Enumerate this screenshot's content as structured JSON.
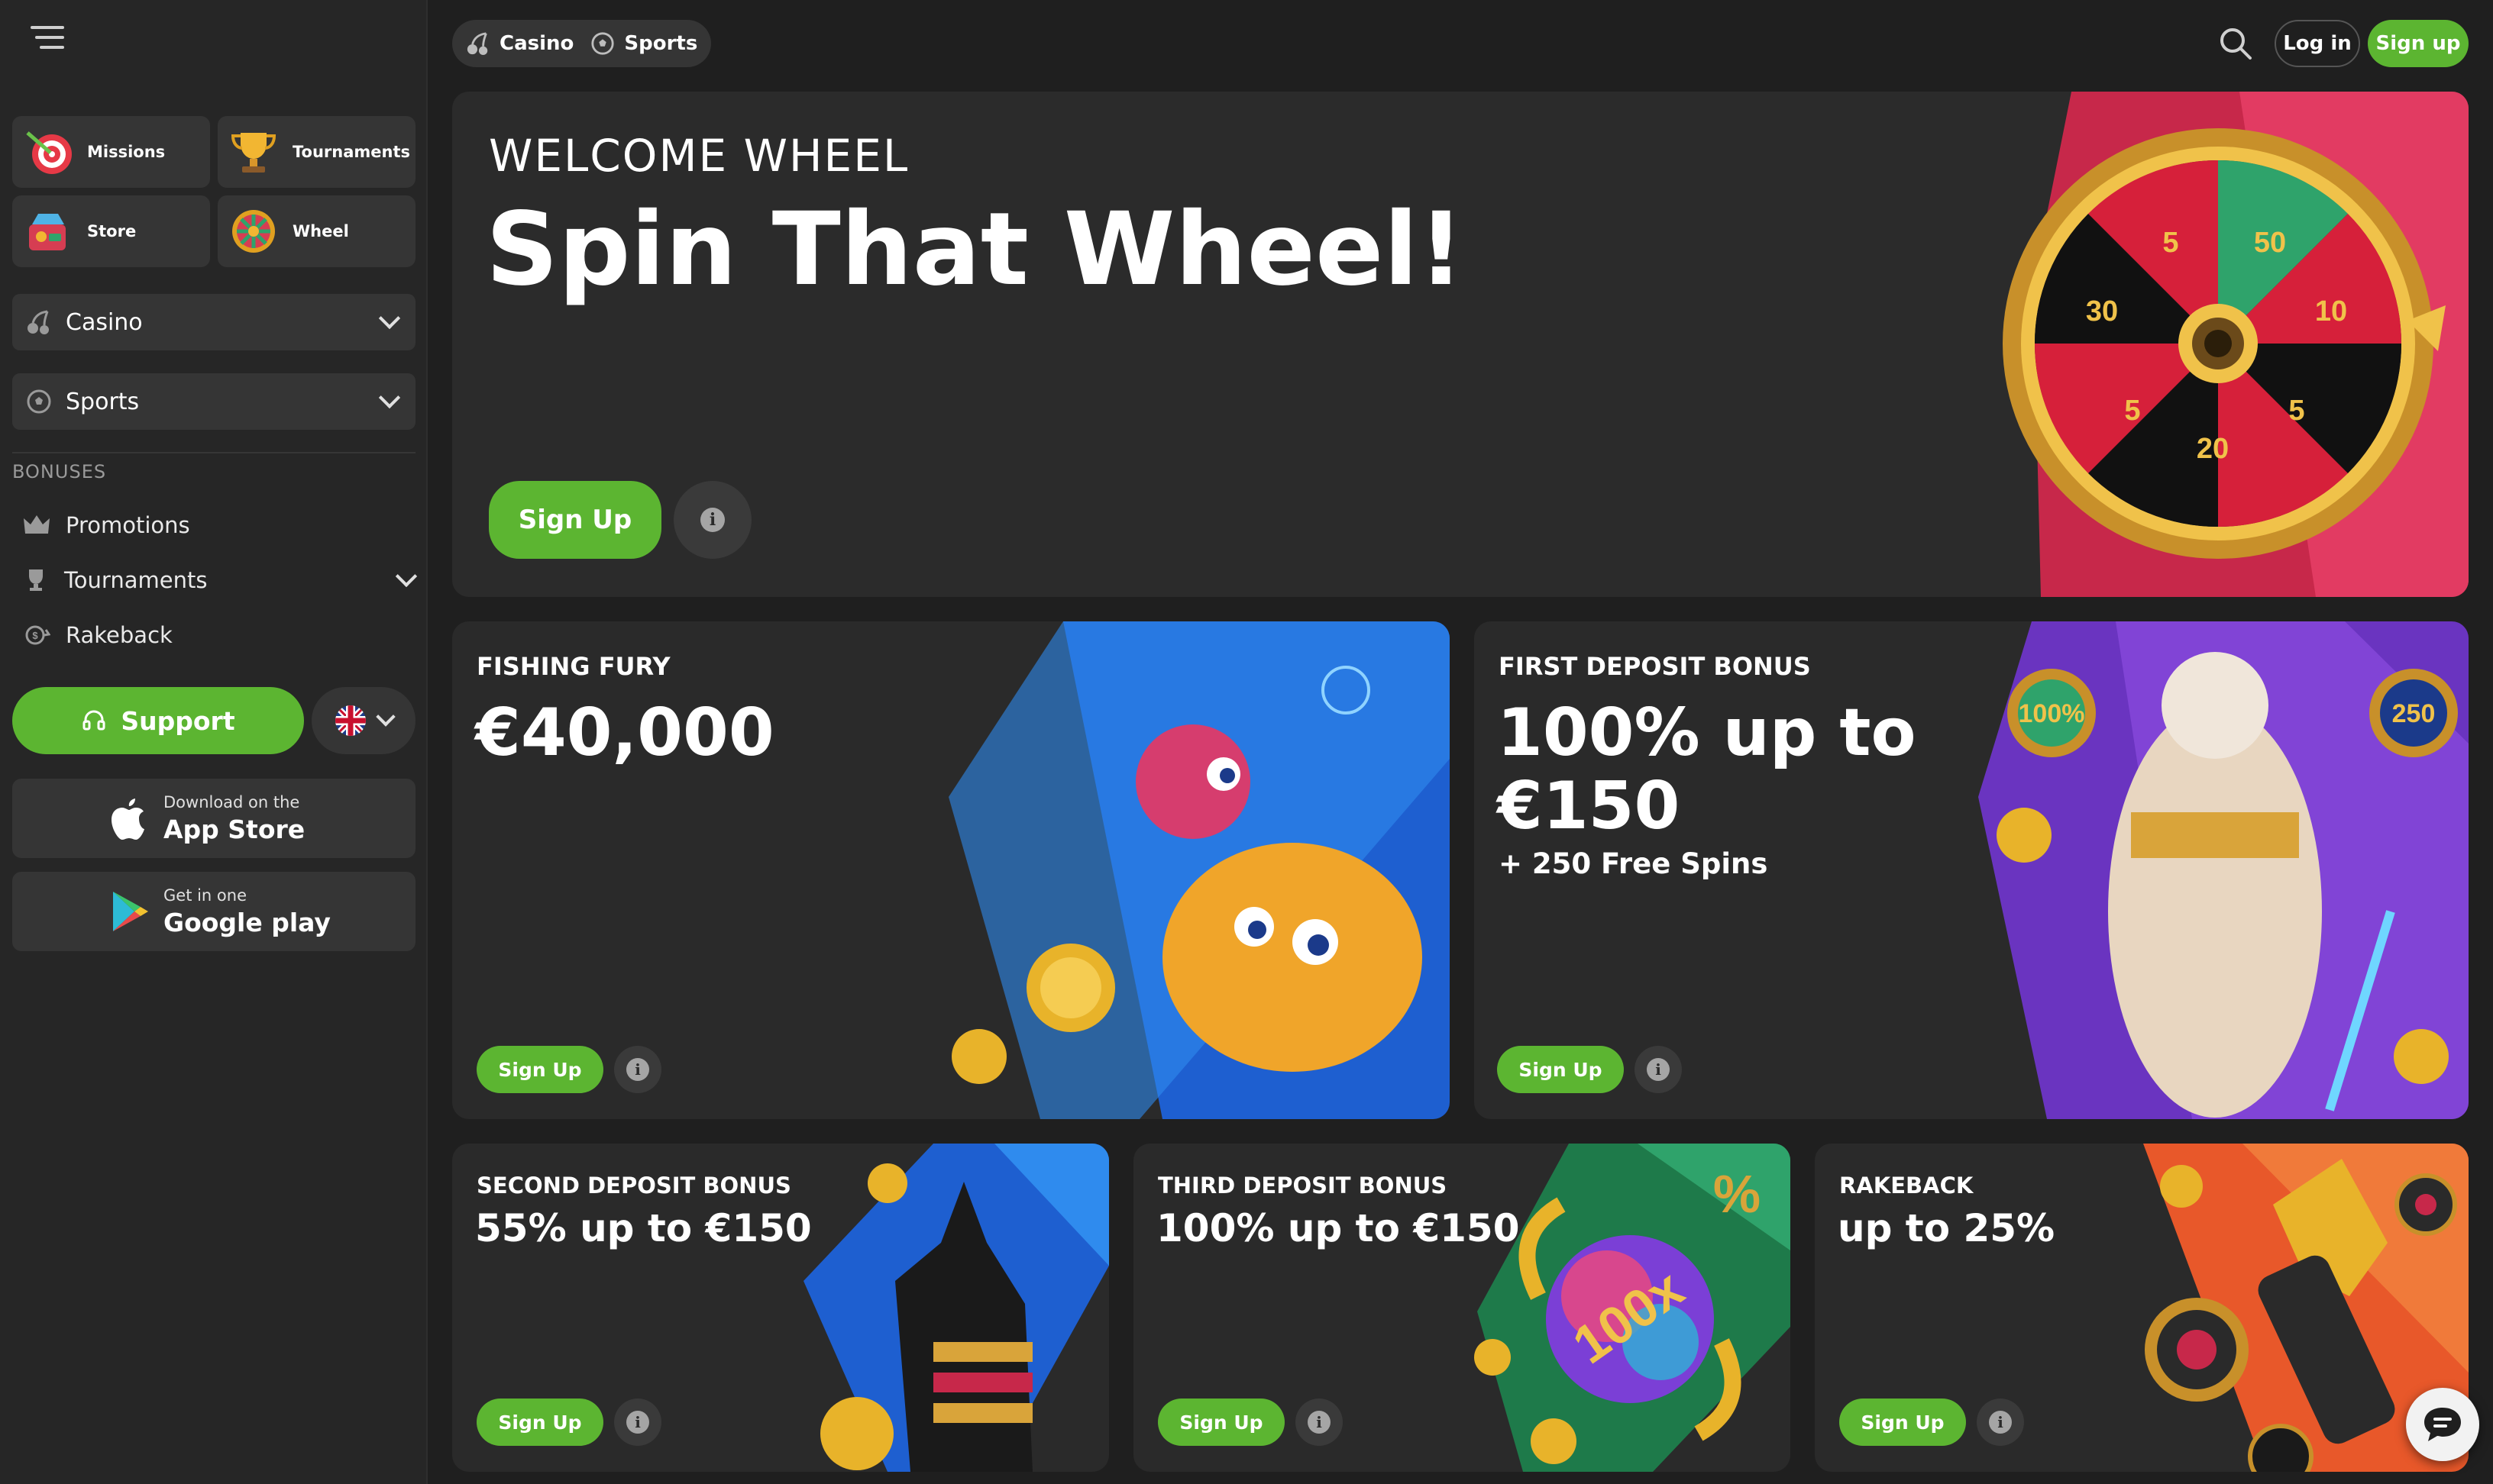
{
  "sidebar": {
    "tiles": [
      {
        "label": "Missions",
        "icon": "dart-target-icon"
      },
      {
        "label": "Tournaments",
        "icon": "trophy-icon"
      },
      {
        "label": "Store",
        "icon": "store-icon"
      },
      {
        "label": "Wheel",
        "icon": "wheel-icon"
      }
    ],
    "casino_label": "Casino",
    "sports_label": "Sports",
    "bonuses_heading": "BONUSES",
    "promotions_label": "Promotions",
    "tournaments_label": "Tournaments",
    "rakeback_label": "Rakeback",
    "support_label": "Support",
    "appstore": {
      "small": "Download on the",
      "big": "App Store"
    },
    "googleplay": {
      "small": "Get in one",
      "big": "Google play"
    }
  },
  "topbar": {
    "casino": "Casino",
    "sports": "Sports",
    "login": "Log in",
    "signup": "Sign up"
  },
  "hero": {
    "kicker": "WELCOME WHEEL",
    "title": "Spin That Wheel!",
    "button": "Sign Up",
    "wheel_values": [
      "5",
      "50",
      "10",
      "5",
      "20",
      "5",
      "30"
    ]
  },
  "cards": {
    "fishing": {
      "kicker": "FISHING FURY",
      "title": "€40,000",
      "button": "Sign Up"
    },
    "first": {
      "kicker": "FIRST DEPOSIT BONUS",
      "title1": "100% up to",
      "title2": "€150",
      "sub": "+ 250 Free Spins",
      "button": "Sign Up",
      "badge1": "100%",
      "badge2": "250"
    },
    "second": {
      "kicker": "SECOND DEPOSIT BONUS",
      "title": "55% up to €150",
      "button": "Sign Up"
    },
    "third": {
      "kicker": "THIRD DEPOSIT BONUS",
      "title": "100% up to €150",
      "button": "Sign Up",
      "ball": "100x",
      "percent": "%"
    },
    "rakeback": {
      "kicker": "RAKEBACK",
      "title": "up to 25%",
      "button": "Sign Up"
    }
  },
  "colors": {
    "accent": "#5cb531",
    "bg": "#1f1f1f",
    "card": "#2a2a2a",
    "sidebar": "#262626"
  }
}
